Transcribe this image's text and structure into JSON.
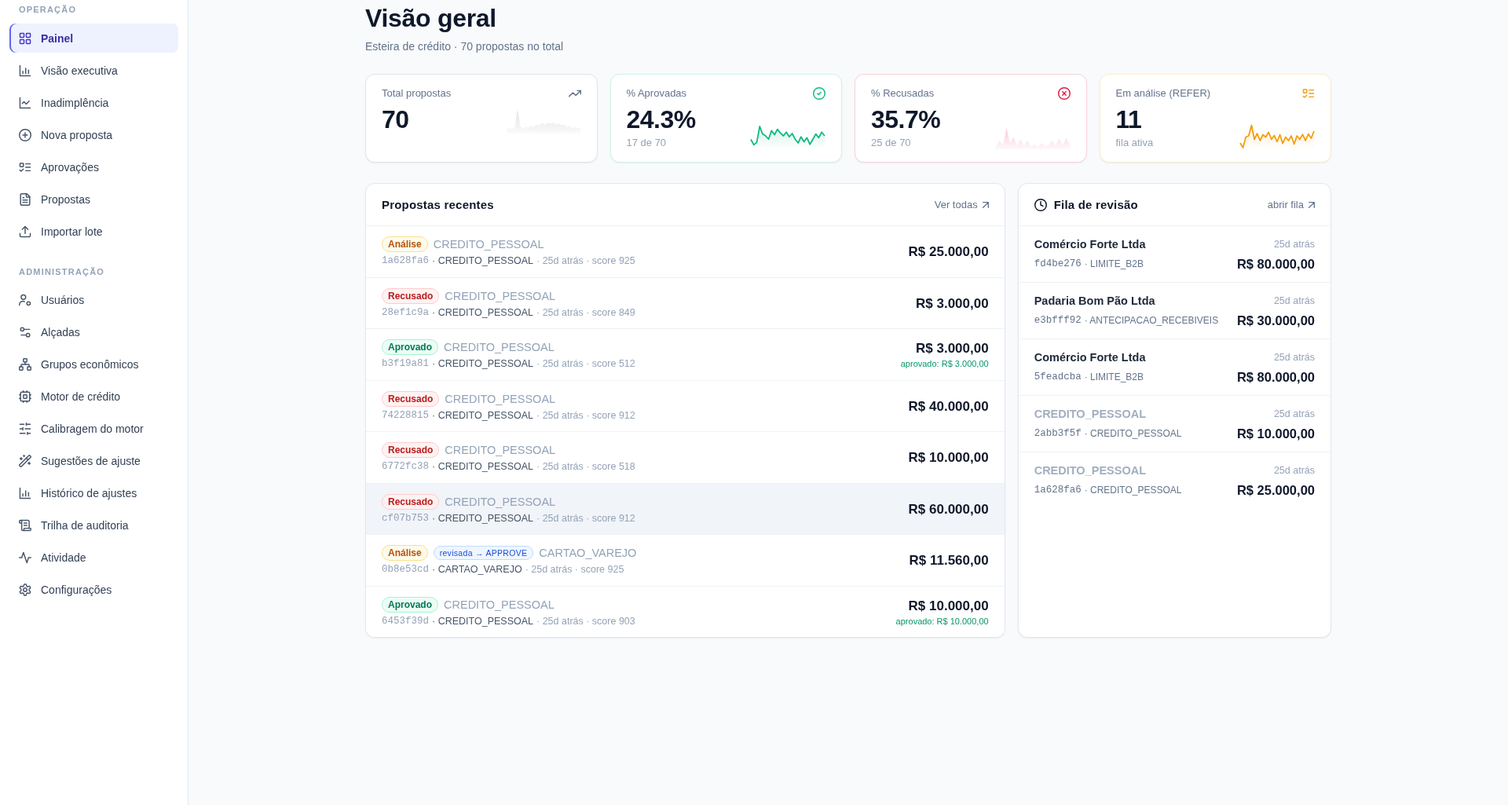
{
  "sidebar": {
    "sections": [
      {
        "title": "OPERAÇÃO",
        "items": [
          {
            "label": "Painel",
            "selected": true
          },
          {
            "label": "Visão executiva",
            "selected": false
          },
          {
            "label": "Inadimplência",
            "selected": false
          },
          {
            "label": "Nova proposta",
            "selected": false
          },
          {
            "label": "Aprovações",
            "selected": false
          },
          {
            "label": "Propostas",
            "selected": false
          },
          {
            "label": "Importar lote",
            "selected": false
          }
        ]
      },
      {
        "title": "ADMINISTRAÇÃO",
        "items": [
          {
            "label": "Usuários",
            "selected": false
          },
          {
            "label": "Alçadas",
            "selected": false
          },
          {
            "label": "Grupos econômicos",
            "selected": false
          },
          {
            "label": "Motor de crédito",
            "selected": false
          },
          {
            "label": "Calibragem do motor",
            "selected": false
          },
          {
            "label": "Sugestões de ajuste",
            "selected": false
          },
          {
            "label": "Histórico de ajustes",
            "selected": false
          },
          {
            "label": "Trilha de auditoria",
            "selected": false
          },
          {
            "label": "Atividade",
            "selected": false
          },
          {
            "label": "Configurações",
            "selected": false
          }
        ]
      }
    ]
  },
  "page": {
    "title": "Visão geral",
    "subtitle": "Esteira de crédito · 70 propostas no total"
  },
  "kpis": [
    {
      "label": "Total propostas",
      "value": "70",
      "color": "#64748b",
      "kind": "area"
    },
    {
      "label": "% Aprovadas",
      "value": "24.3%",
      "sub": "17 de 70",
      "color": "#10b981",
      "kind": "line"
    },
    {
      "label": "% Recusadas",
      "value": "35.7%",
      "sub": "25 de 70",
      "color": "#e11d48",
      "kind": "area"
    },
    {
      "label": "Em análise (REFER)",
      "value": "11",
      "sub": "fila ativa",
      "color": "#f59e0b",
      "kind": "line"
    }
  ],
  "recent": {
    "title": "Propostas recentes",
    "link": "Ver todas",
    "rows": [
      {
        "status": {
          "label": "Análise",
          "kind": "review"
        },
        "title": "CREDITO_PESSOAL",
        "id": "1a628fa6",
        "product": "· CREDITO_PESSOAL",
        "details": "· 25d atrás · score 925",
        "amount": "R$ 25.000,00",
        "highlighted": false
      },
      {
        "status": {
          "label": "Recusado",
          "kind": "rejected"
        },
        "title": "CREDITO_PESSOAL",
        "id": "28ef1c9a",
        "product": "· CREDITO_PESSOAL",
        "details": "· 25d atrás · score 849",
        "amount": "R$ 3.000,00",
        "highlighted": false
      },
      {
        "status": {
          "label": "Aprovado",
          "kind": "approved"
        },
        "title": "CREDITO_PESSOAL",
        "id": "b3f19a81",
        "product": "· CREDITO_PESSOAL",
        "details": "· 25d atrás · score 512",
        "amount": "R$ 3.000,00",
        "approved_note": "aprovado: R$ 3.000,00",
        "highlighted": false
      },
      {
        "status": {
          "label": "Recusado",
          "kind": "rejected"
        },
        "title": "CREDITO_PESSOAL",
        "id": "74228815",
        "product": "· CREDITO_PESSOAL",
        "details": "· 25d atrás · score 912",
        "amount": "R$ 40.000,00",
        "highlighted": false
      },
      {
        "status": {
          "label": "Recusado",
          "kind": "rejected"
        },
        "title": "CREDITO_PESSOAL",
        "id": "6772fc38",
        "product": "· CREDITO_PESSOAL",
        "details": "· 25d atrás · score 518",
        "amount": "R$ 10.000,00",
        "highlighted": false
      },
      {
        "status": {
          "label": "Recusado",
          "kind": "rejected"
        },
        "title": "CREDITO_PESSOAL",
        "id": "cf07b753",
        "product": "· CREDITO_PESSOAL",
        "details": "· 25d atrás · score 912",
        "amount": "R$ 60.000,00",
        "highlighted": true
      },
      {
        "status": {
          "label": "Análise",
          "kind": "review"
        },
        "review_tag": "revisada → APPROVE",
        "title": "CARTAO_VAREJO",
        "id": "0b8e53cd",
        "product": "· CARTAO_VAREJO",
        "details": "· 25d atrás · score 925",
        "amount": "R$ 11.560,00",
        "highlighted": false
      },
      {
        "status": {
          "label": "Aprovado",
          "kind": "approved"
        },
        "title": "CREDITO_PESSOAL",
        "id": "6453f39d",
        "product": "· CREDITO_PESSOAL",
        "details": "· 25d atrás · score 903",
        "amount": "R$ 10.000,00",
        "approved_note": "aprovado: R$ 10.000,00",
        "highlighted": false
      }
    ]
  },
  "review_queue": {
    "title": "Fila de revisão",
    "link": "abrir fila",
    "rows": [
      {
        "name": "Comércio Forte Ltda",
        "muted": false,
        "age": "25d atrás",
        "id": "fd4be276",
        "product": "· LIMITE_B2B",
        "amount": "R$ 80.000,00"
      },
      {
        "name": "Padaria Bom Pão Ltda",
        "muted": false,
        "age": "25d atrás",
        "id": "e3bfff92",
        "product": "· ANTECIPACAO_RECEBIVEIS",
        "amount": "R$ 30.000,00"
      },
      {
        "name": "Comércio Forte Ltda",
        "muted": false,
        "age": "25d atrás",
        "id": "5feadcba",
        "product": "· LIMITE_B2B",
        "amount": "R$ 80.000,00"
      },
      {
        "name": "CREDITO_PESSOAL",
        "muted": true,
        "age": "25d atrás",
        "id": "2abb3f5f",
        "product": "· CREDITO_PESSOAL",
        "amount": "R$ 10.000,00"
      },
      {
        "name": "CREDITO_PESSOAL",
        "muted": true,
        "age": "25d atrás",
        "id": "1a628fa6",
        "product": "· CREDITO_PESSOAL",
        "amount": "R$ 25.000,00"
      }
    ]
  }
}
